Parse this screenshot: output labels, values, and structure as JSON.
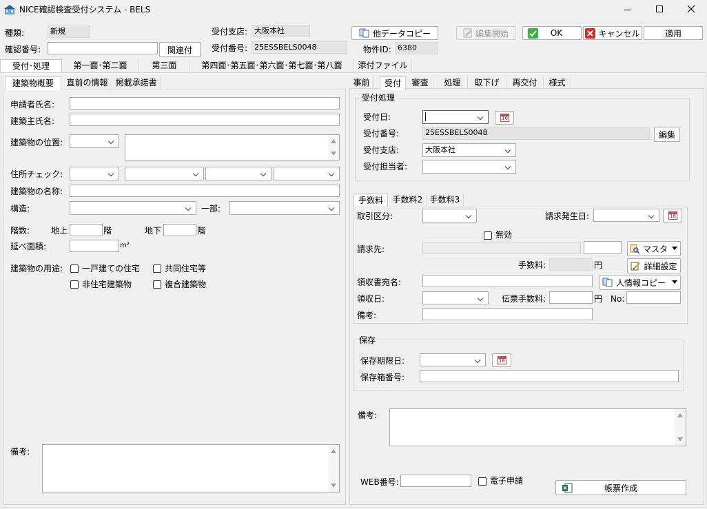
{
  "window": {
    "title": "NICE確認検査受付システム - BELS"
  },
  "header": {
    "kind_label": "種類:",
    "kind_value": "新規",
    "confirm_no_label": "確認番号:",
    "confirm_no_value": "",
    "link_button": "関連付",
    "branch_label": "受付支店:",
    "branch_value": "大阪本社",
    "receipt_no_label": "受付番号:",
    "receipt_no_value": "25ESSBELS0048",
    "property_id_label": "物件ID:",
    "property_id_value": "6380",
    "copy_button": "他データコピー",
    "edit_button": "編集開始",
    "ok_button": "OK",
    "cancel_button": "キャンセル",
    "apply_button": "適用"
  },
  "main_tabs": [
    "受付･処理",
    "第一面･第二面",
    "第三面",
    "第四面･第五面･第六面･第七面･第八面",
    "添付ファイル"
  ],
  "left": {
    "tabs": [
      "建築物概要",
      "直前の情報",
      "掲載承諾書"
    ],
    "applicant_label": "申請者氏名:",
    "owner_label": "建築主氏名:",
    "location_label": "建築物の位置:",
    "address_check_label": "住所チェック:",
    "building_name_label": "建築物の名称:",
    "structure_label": "構造:",
    "partial_label": "一部:",
    "floors_label": "階数:",
    "above_label": "地上",
    "floor_unit": "階",
    "below_label": "地下",
    "area_label": "延べ面積:",
    "area_unit": "m²",
    "use_label": "建築物の用途:",
    "use_options": [
      "一戸建ての住宅",
      "共同住宅等",
      "非住宅建築物",
      "複合建築物"
    ],
    "remarks_label": "備考:"
  },
  "right": {
    "tabs": [
      "事前",
      "受付",
      "審査",
      "処理",
      "取下げ",
      "再交付",
      "様式"
    ],
    "reception_group": "受付処理",
    "reception_date_label": "受付日:",
    "reception_date_value": "",
    "reception_no_label": "受付番号:",
    "reception_no_value": "25ESSBELS0048",
    "edit_button": "編集",
    "branch_label": "受付支店:",
    "branch_value": "大阪本社",
    "staff_label": "受付担当者:",
    "fee_tabs": [
      "手数料",
      "手数料2",
      "手数料3"
    ],
    "trade_label": "取引区分:",
    "invoice_date_label": "請求発生日:",
    "invalid_label": "無効",
    "billing_label": "請求先:",
    "master_button": "マスタ",
    "fee_label": "手数料:",
    "yen": "円",
    "detail_button": "詳細設定",
    "receipt_name_label": "領収書宛名:",
    "person_copy_button": "人情報コピー",
    "receipt_date_label": "領収日:",
    "slip_fee_label": "伝票手数料:",
    "no_label": "No:",
    "fee_remarks_label": "備考:",
    "storage_group": "保存",
    "storage_deadline_label": "保存期限日:",
    "storage_box_label": "保存箱番号:",
    "remarks_label": "備考:",
    "web_no_label": "WEB番号:",
    "e_apply_label": "電子申請",
    "report_button": "帳票作成"
  }
}
